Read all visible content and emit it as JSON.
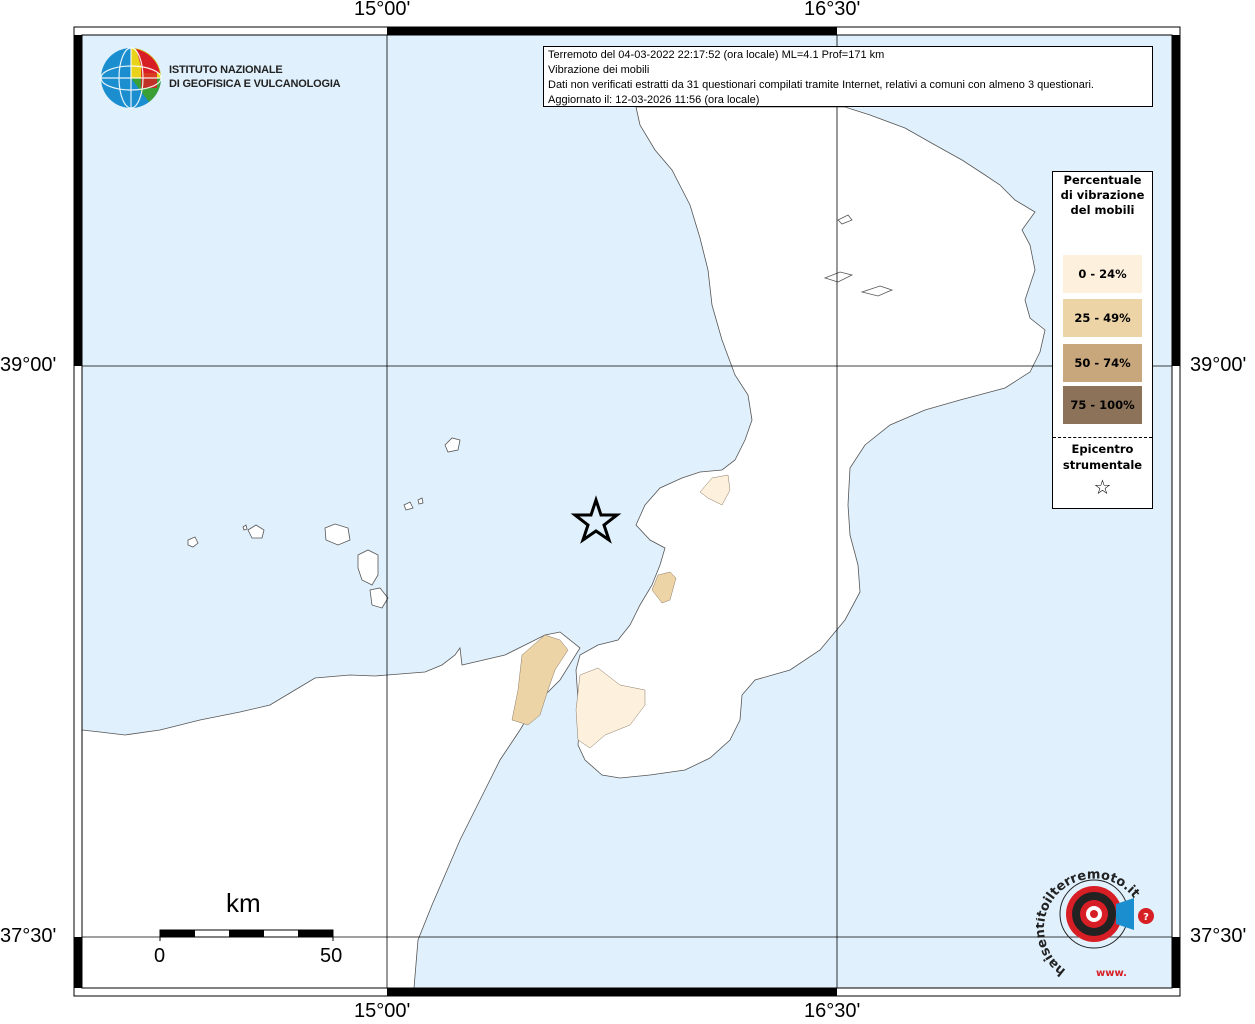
{
  "info": {
    "line1": "Terremoto del 04-03-2022 22:17:52 (ora locale) ML=4.1 Prof=171 km",
    "line2": "Vibrazione dei mobili",
    "line3": "Dati non verificati estratti da 31 questionari compilati tramite Internet, relativi a comuni con almeno 3 questionari.",
    "line4": "Aggiornato il: 12-03-2026 11:56 (ora locale)"
  },
  "logo": {
    "line1": "ISTITUTO NAZIONALE",
    "line2": "DI GEOFISICA E VULCANOLOGIA"
  },
  "legend": {
    "title": "Percentuale di vibrazione del mobili",
    "items": [
      {
        "label": "0 - 24%",
        "color": "#fdf0dc"
      },
      {
        "label": "25 - 49%",
        "color": "#ecd4a7"
      },
      {
        "label": "50 - 74%",
        "color": "#c9a77d"
      },
      {
        "label": "75 - 100%",
        "color": "#8c7259"
      }
    ],
    "epicenter_label": "Epicentro strumentale",
    "epicenter_symbol": "☆"
  },
  "axes": {
    "lon_left": "15°00'",
    "lon_right": "16°30'",
    "lat_top": "39°00'",
    "lat_bottom": "37°30'"
  },
  "scale": {
    "unit": "km",
    "start": "0",
    "end": "50"
  },
  "watermark": {
    "text": "haisentitoilterremoto.it",
    "prefix": "www."
  },
  "colors": {
    "sea": "#e0f1fd",
    "land": "#ffffff",
    "accent": "#d81e25"
  }
}
